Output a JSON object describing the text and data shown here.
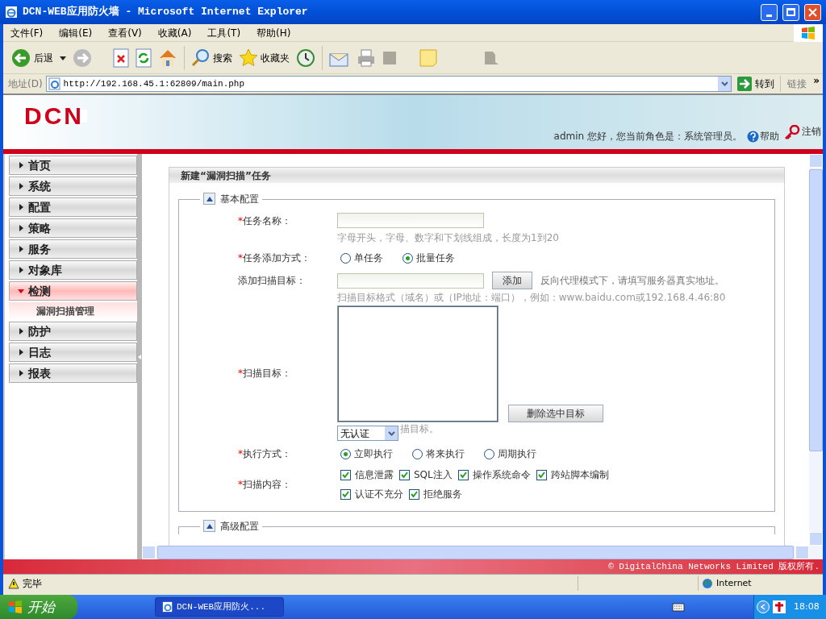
{
  "window": {
    "title": "DCN-WEB应用防火墙 - Microsoft Internet Explorer"
  },
  "menu": [
    "文件(F)",
    "编辑(E)",
    "查看(V)",
    "收藏(A)",
    "工具(T)",
    "帮助(H)"
  ],
  "toolbar": {
    "back": "后退",
    "search": "搜索",
    "favorites": "收藏夹"
  },
  "address": {
    "label": "地址(D)",
    "url": "http://192.168.45.1:62809/main.php",
    "go": "转到",
    "links": "链接",
    "more": "»"
  },
  "header": {
    "logo": "DCN",
    "greeting": "admin 您好，您当前角色是：系统管理员。",
    "help": "帮助",
    "logout": "注销"
  },
  "sidebar": [
    {
      "label": "首页",
      "expanded": false
    },
    {
      "label": "系统",
      "expanded": false
    },
    {
      "label": "配置",
      "expanded": false
    },
    {
      "label": "策略",
      "expanded": false
    },
    {
      "label": "服务",
      "expanded": false
    },
    {
      "label": "对象库",
      "expanded": false
    },
    {
      "label": "检测",
      "expanded": true,
      "children": [
        {
          "label": "漏洞扫描管理",
          "selected": true
        }
      ]
    },
    {
      "label": "防护",
      "expanded": false
    },
    {
      "label": "日志",
      "expanded": false
    },
    {
      "label": "报表",
      "expanded": false
    }
  ],
  "panel": {
    "title": "新建“漏洞扫描”任务",
    "required_mark": "*",
    "basic": {
      "title": "基本配置",
      "expanded": true
    },
    "task_name": {
      "label": "任务名称：",
      "required": true,
      "hint": "字母开头，字母、数字和下划线组成，长度为1到20"
    },
    "add_mode": {
      "label": "任务添加方式：",
      "required": true,
      "options": [
        {
          "label": "单任务",
          "selected": false
        },
        {
          "label": "批量任务",
          "selected": true
        }
      ]
    },
    "add_target": {
      "label": "添加扫描目标：",
      "required": false,
      "button": "添加",
      "note": "反向代理模式下，请填写服务器真实地址。",
      "hint": "扫描目标格式（域名）或（IP地址：端口），例如：www.baidu.com或192.168.4.46:80"
    },
    "targets": {
      "label": "扫描目标：",
      "required": true,
      "button": "删除选中目标",
      "hint": "描目标。",
      "auth": "无认证"
    },
    "exec_mode": {
      "label": "执行方式：",
      "required": true,
      "options": [
        {
          "label": "立即执行",
          "selected": true
        },
        {
          "label": "将来执行",
          "selected": false
        },
        {
          "label": "周期执行",
          "selected": false
        }
      ]
    },
    "scan_content": {
      "label": "扫描内容：",
      "required": true,
      "options": [
        {
          "label": "信息泄露",
          "checked": true
        },
        {
          "label": "SQL注入",
          "checked": true
        },
        {
          "label": "操作系统命令",
          "checked": true
        },
        {
          "label": "跨站脚本编制",
          "checked": true
        },
        {
          "label": "认证不充分",
          "checked": true
        },
        {
          "label": "拒绝服务",
          "checked": true
        }
      ]
    },
    "advanced": {
      "title": "高级配置",
      "expanded": true
    }
  },
  "footer": "© DigitalChina Networks Limited 版权所有.",
  "status": {
    "text": "完毕",
    "zone": "Internet"
  },
  "taskbar": {
    "start": "开始",
    "task": "DCN-WEB应用防火...",
    "clock": "18:08"
  }
}
